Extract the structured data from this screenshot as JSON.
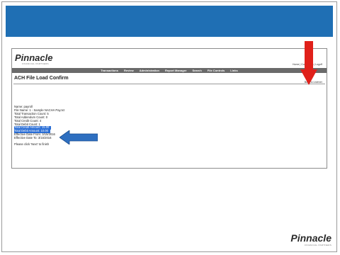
{
  "app": {
    "logo_text": "Pinnacle",
    "logo_tagline": "FINANCIAL PARTNERS",
    "top_links": "Home | Contact Us | Logoff"
  },
  "nav": {
    "items": [
      "Transactions",
      "Review",
      "Administration",
      "Report Manager",
      "Search",
      "File Controls",
      "Links"
    ]
  },
  "page": {
    "title": "ACH File Load Confirm",
    "back_link": "Back to Listener"
  },
  "details": {
    "lines": [
      "Name: payroll",
      "File Name: 1 - Sample NACHA Pay.txt",
      "Total Transaction Count: 5",
      "Total Addendum Count: 0",
      "Total Credit Count: 4",
      "Total Debit Count: 1",
      "Total Credit Amount: 15.00",
      "Total Debit Amount: 10.00",
      "Effective Date From: 3/15/2016",
      "Effective Date To: 3/15/2016"
    ],
    "note": "Please click 'Next' to finish"
  },
  "colors": {
    "banner": "#1f6fb4",
    "highlight": "#2a6ed6",
    "arrow_red": "#e0201a",
    "arrow_blue": "#2e6fc0"
  },
  "footer": {
    "logo_text": "Pinnacle",
    "logo_tagline": "FINANCIAL PARTNERS"
  }
}
